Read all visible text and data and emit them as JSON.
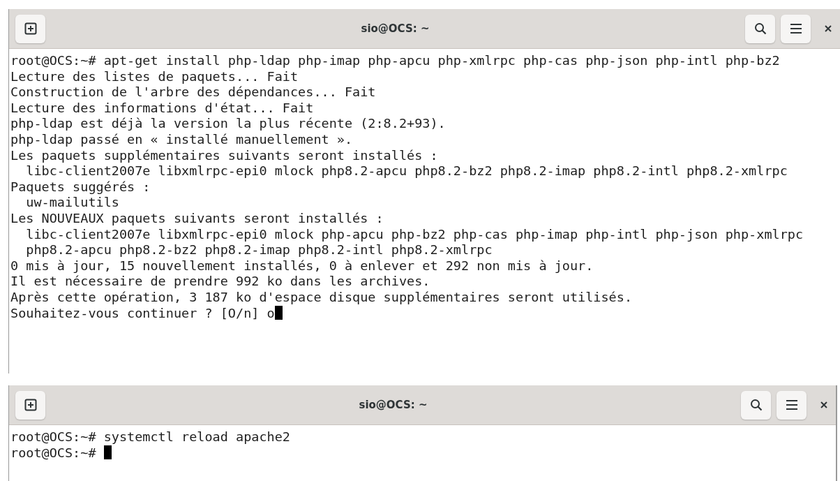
{
  "windows": [
    {
      "title": "sio@OCS: ~",
      "cursor": true,
      "lines": [
        "root@OCS:~# apt-get install php-ldap php-imap php-apcu php-xmlrpc php-cas php-json php-intl php-bz2",
        "Lecture des listes de paquets... Fait",
        "Construction de l'arbre des dépendances... Fait",
        "Lecture des informations d'état... Fait",
        "php-ldap est déjà la version la plus récente (2:8.2+93).",
        "php-ldap passé en « installé manuellement ».",
        "Les paquets supplémentaires suivants seront installés :",
        "  libc-client2007e libxmlrpc-epi0 mlock php8.2-apcu php8.2-bz2 php8.2-imap php8.2-intl php8.2-xmlrpc",
        "Paquets suggérés :",
        "  uw-mailutils",
        "Les NOUVEAUX paquets suivants seront installés :",
        "  libc-client2007e libxmlrpc-epi0 mlock php-apcu php-bz2 php-cas php-imap php-intl php-json php-xmlrpc",
        "  php8.2-apcu php8.2-bz2 php8.2-imap php8.2-intl php8.2-xmlrpc",
        "0 mis à jour, 15 nouvellement installés, 0 à enlever et 292 non mis à jour.",
        "Il est nécessaire de prendre 992 ko dans les archives.",
        "Après cette opération, 3 187 ko d'espace disque supplémentaires seront utilisés.",
        "Souhaitez-vous continuer ? [O/n] o"
      ]
    },
    {
      "title": "sio@OCS: ~",
      "cursor": true,
      "lines": [
        "root@OCS:~# systemctl reload apache2",
        "root@OCS:~# "
      ]
    }
  ]
}
